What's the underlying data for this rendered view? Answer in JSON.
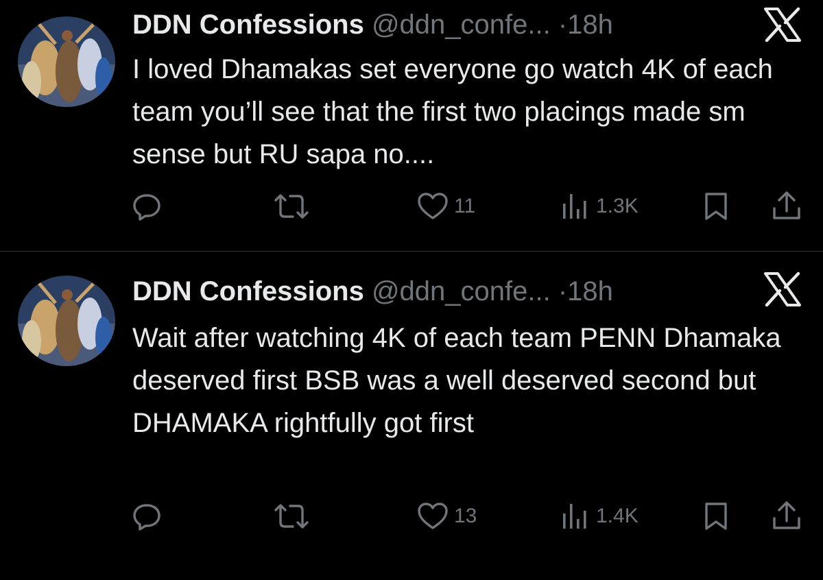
{
  "tweets": [
    {
      "author_name": "DDN Confessions",
      "handle": "@ddn_confe...",
      "separator": "·",
      "time": "18h",
      "text": "I loved Dhamakas set everyone go watch 4K of each team you’ll see that the first two placings made sm sense but RU sapa no....",
      "likes": "11",
      "views": "1.3K"
    },
    {
      "author_name": "DDN Confessions",
      "handle": "@ddn_confe...",
      "separator": "·",
      "time": "18h",
      "text": "Wait after watching 4K of each team PENN Dhamaka deserved first BSB was a well deserved second but DHAMAKA rightfully got first",
      "likes": "13",
      "views": "1.4K"
    }
  ],
  "icons": {
    "reply": "reply-icon",
    "retweet": "retweet-icon",
    "like": "heart-icon",
    "views": "views-icon",
    "bookmark": "bookmark-icon",
    "share": "share-icon",
    "brand": "x-logo-icon"
  },
  "colors": {
    "background": "#000000",
    "text_primary": "#e7e9ea",
    "text_secondary": "#71767b",
    "divider": "#2f3336"
  }
}
